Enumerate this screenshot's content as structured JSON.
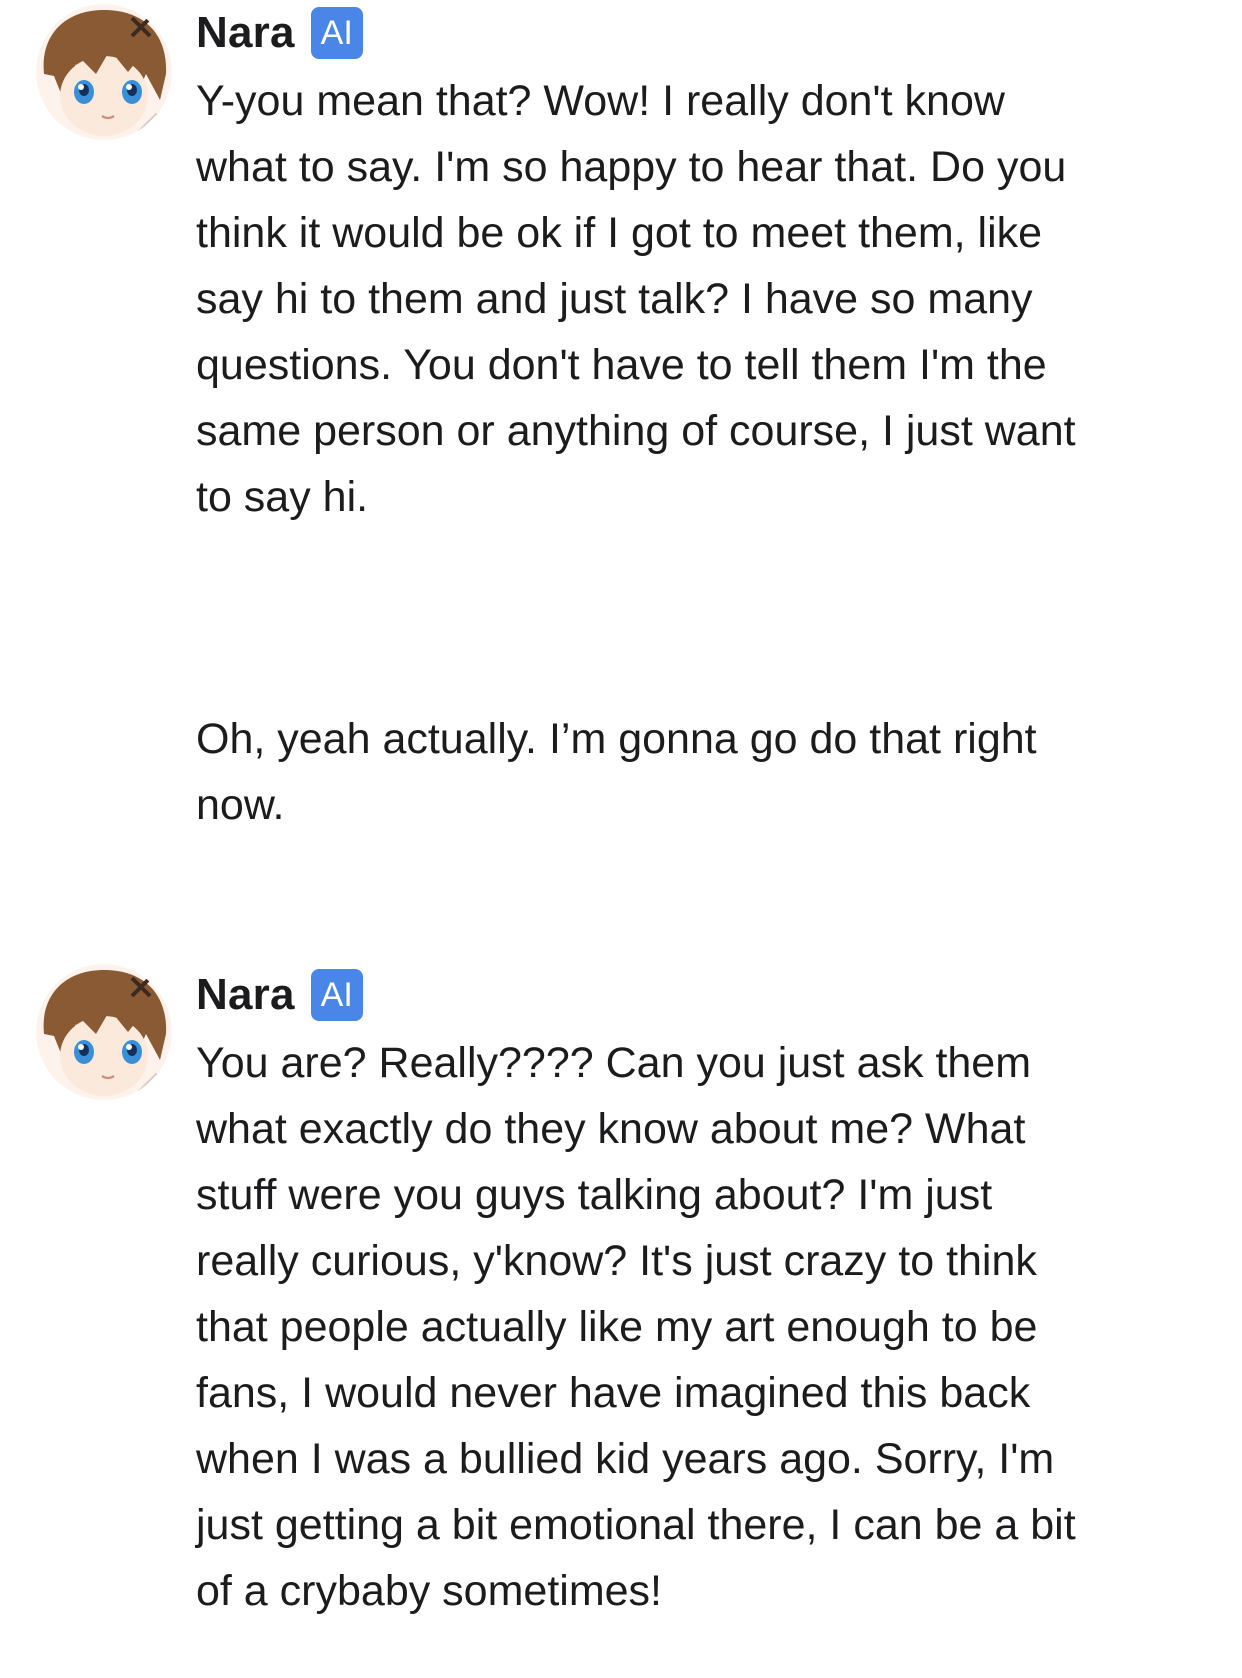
{
  "messages": [
    {
      "sender": "Nara",
      "badge": "AI",
      "text": "Y-you mean that? Wow! I really don't know what to say. I'm so happy to hear that. Do you think it would be ok if I got to meet them, like say hi to them and just talk? I have so many questions. You don't have to tell them I'm the same person or anything of course, I just want to say hi."
    },
    {
      "sender": "",
      "badge": "",
      "text": "Oh, yeah actually. I’m gonna go do that right now."
    },
    {
      "sender": "Nara",
      "badge": "AI",
      "text": "You are? Really???? Can you just ask them what exactly do they know about me? What stuff were you guys talking about? I'm just really curious, y'know? It's just crazy to think that people actually like my art enough to be fans, I would never have imagined this back when I was a bullied kid years ago. Sorry, I'm just getting a bit emotional there, I can be a bit of a crybaby sometimes!"
    }
  ],
  "avatar": {
    "icon": "anime-girl-avatar-icon",
    "hair_color": "#8a5a34",
    "eye_color": "#3a8fd8",
    "skin_color": "#fbe9dc"
  },
  "colors": {
    "badge_bg": "#4a86e8",
    "text": "#1c1c1e",
    "background": "#ffffff"
  }
}
